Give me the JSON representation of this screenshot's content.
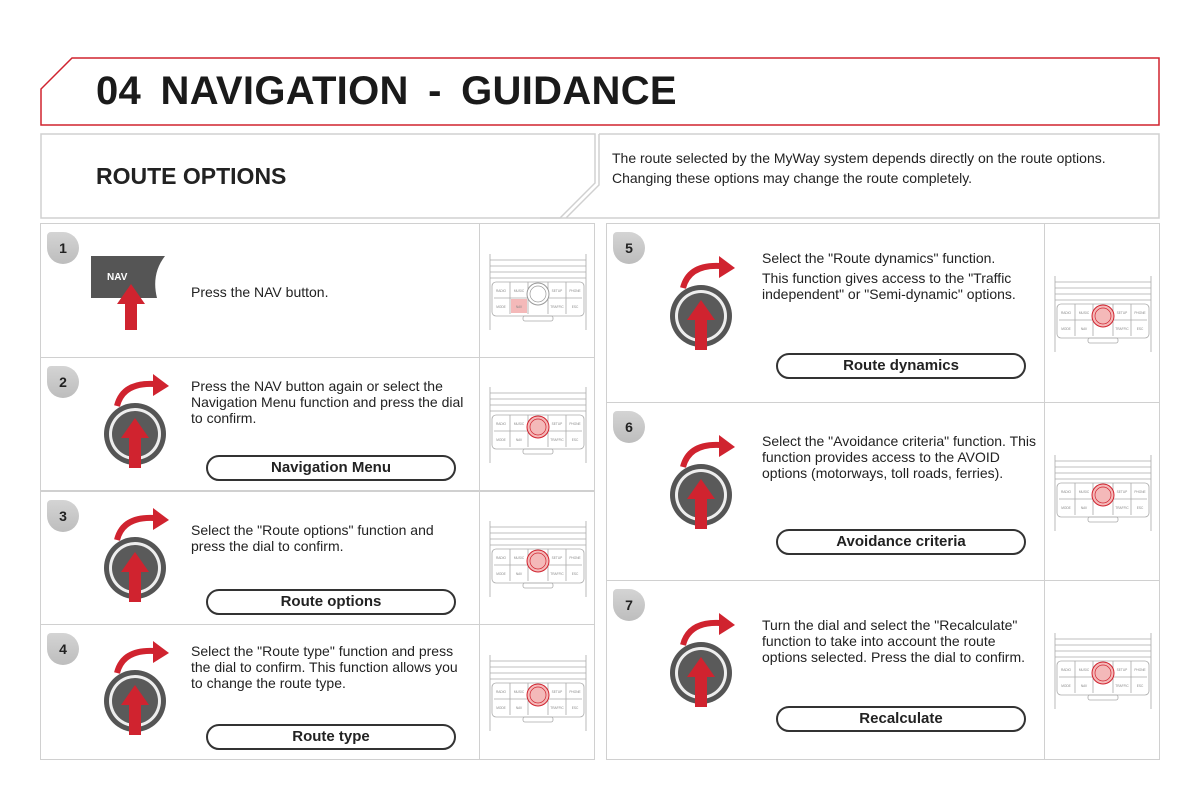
{
  "header": {
    "chapter": "04",
    "title": "NAVIGATION - GUIDANCE"
  },
  "intro": {
    "heading": "ROUTE OPTIONS",
    "paragraphs": [
      "The route selected by the MyWay system depends directly on the route options.",
      "Changing these options may change the route completely."
    ]
  },
  "panel_labels": [
    "RADIO",
    "MUSIC",
    "SETUP",
    "PHONE",
    "MODE",
    "NAV",
    "TRAFFIC",
    "ESC"
  ],
  "colors": {
    "accent": "#d0232f",
    "frame": "#d0d0d0"
  },
  "steps": [
    {
      "number": "1",
      "icon": "nav-button-press-icon",
      "button_text": "NAV",
      "paragraphs": [
        "Press the NAV button."
      ],
      "highlight": "nav-button"
    },
    {
      "number": "2",
      "icon": "dial-turn-press-icon",
      "paragraphs": [
        "Press the NAV button again or select the Navigation Menu function and press the dial to confirm."
      ],
      "menu_label": "Navigation Menu",
      "highlight": "dial"
    },
    {
      "number": "3",
      "icon": "dial-turn-press-icon",
      "paragraphs": [
        "Select the \"Route options\" function and press the dial to confirm."
      ],
      "menu_label": "Route options",
      "highlight": "dial"
    },
    {
      "number": "4",
      "icon": "dial-turn-press-icon",
      "paragraphs": [
        "Select the \"Route type\" function and press the dial to confirm. This function allows you to change the route type."
      ],
      "menu_label": "Route type",
      "highlight": "dial"
    },
    {
      "number": "5",
      "icon": "dial-turn-press-icon",
      "paragraphs": [
        "Select the \"Route dynamics\" function.",
        "This function gives access to the \"Traffic independent\" or \"Semi-dynamic\" options."
      ],
      "menu_label": "Route dynamics",
      "highlight": "dial"
    },
    {
      "number": "6",
      "icon": "dial-turn-press-icon",
      "paragraphs": [
        "Select the \"Avoidance criteria\" function. This function provides access to the AVOID options (motorways, toll roads, ferries)."
      ],
      "menu_label": "Avoidance criteria",
      "highlight": "dial"
    },
    {
      "number": "7",
      "icon": "dial-turn-press-icon",
      "paragraphs": [
        "Turn the dial and select the \"Recalculate\" function to take into account the route options selected. Press the dial to confirm."
      ],
      "menu_label": "Recalculate",
      "highlight": "dial"
    }
  ]
}
